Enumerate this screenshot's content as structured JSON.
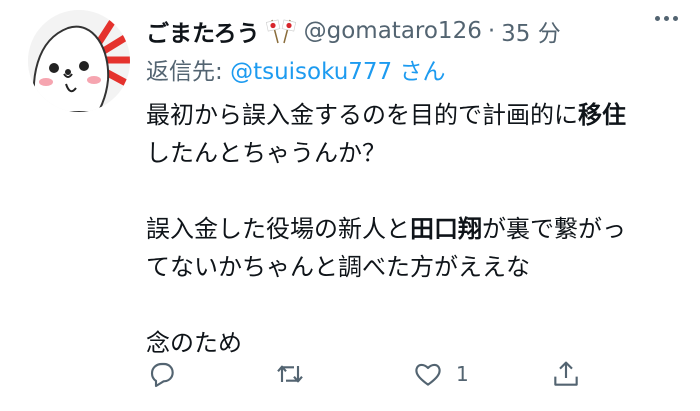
{
  "tweet": {
    "display_name": "ごまたろう",
    "handle": "@gomataro126",
    "separator": "·",
    "time": "35 分",
    "reply_prefix": "返信先: ",
    "reply_to": "@tsuisoku777",
    "reply_suffix": " さん",
    "body": {
      "l1_a": "最初から誤入金するのを目的で計画的に",
      "l1_b": "移住",
      "l2": "したんとちゃうんか？",
      "l3_a": "誤入金した役場の新人と",
      "l3_b": "田口翔",
      "l3_c": "が裏で繋がっ",
      "l4": "てないかちゃんと調べた方がええな",
      "l5": "念のため"
    },
    "actions": {
      "reply_icon": "reply-icon",
      "retweet_icon": "retweet-icon",
      "like_icon": "heart-icon",
      "like_count": "1",
      "share_icon": "share-icon"
    }
  },
  "colors": {
    "text": "#0f1419",
    "secondary": "#536471",
    "link": "#1d9bf0"
  }
}
